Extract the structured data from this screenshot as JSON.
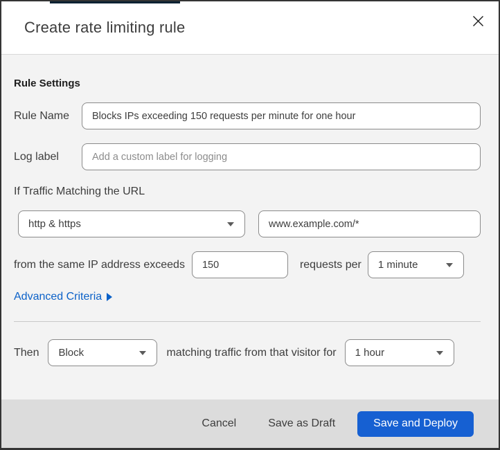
{
  "header": {
    "title": "Create rate limiting rule",
    "close_icon": "x-close"
  },
  "form": {
    "section_heading": "Rule Settings",
    "rule_name": {
      "label": "Rule Name",
      "value": "Blocks IPs exceeding 150 requests per minute for one hour"
    },
    "log_label": {
      "label": "Log label",
      "placeholder": "Add a custom label for logging"
    },
    "traffic_intro": "If Traffic Matching the URL",
    "scheme_select": {
      "value": "http & https"
    },
    "url_input": {
      "value": "www.example.com/*"
    },
    "threshold": {
      "prefix": "from the same IP address exceeds",
      "value": "150",
      "suffix": "requests per"
    },
    "period_select": {
      "value": "1 minute"
    },
    "advanced_link": {
      "label": "Advanced Criteria"
    },
    "action": {
      "prefix": "Then",
      "action_select": {
        "value": "Block"
      },
      "middle": "matching traffic from that visitor for",
      "duration_select": {
        "value": "1 hour"
      }
    }
  },
  "footer": {
    "cancel": "Cancel",
    "save_draft": "Save as Draft",
    "save_deploy": "Save and Deploy"
  },
  "colors": {
    "accent_link": "#0b61c8",
    "primary_button": "#1660d2",
    "body_background": "#f3f3f3",
    "footer_background": "#dcdcdc",
    "top_strip": "#0c2233"
  }
}
